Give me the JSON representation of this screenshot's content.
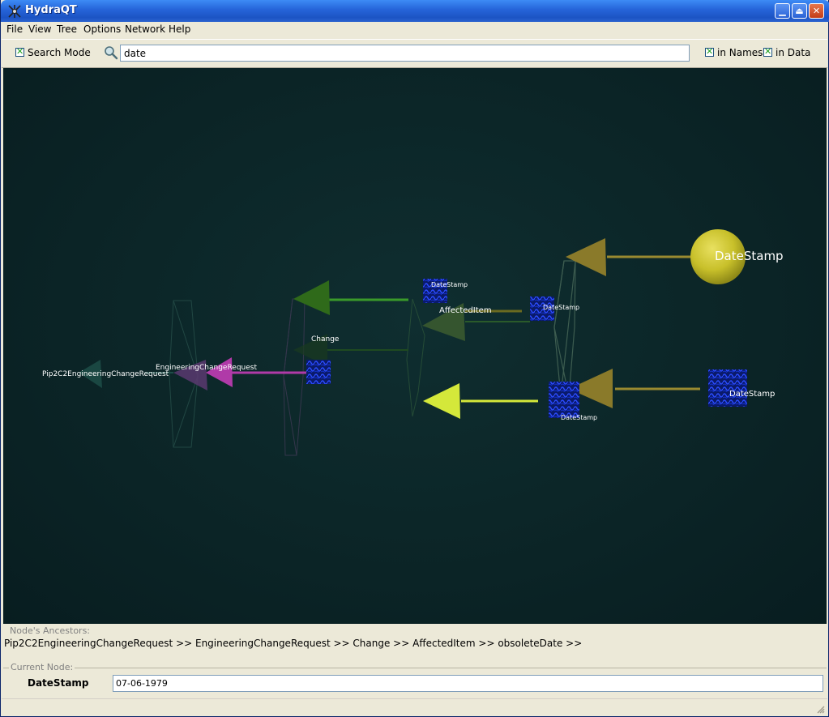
{
  "window": {
    "title": "HydraQT"
  },
  "menu": [
    "File",
    "View",
    "Tree",
    "Options",
    "Network",
    "Help"
  ],
  "toolbar": {
    "search_mode_label": "Search Mode",
    "search_mode_checked": true,
    "search_value": "date",
    "in_names_label": "in Names",
    "in_names_checked": true,
    "in_data_label": "in Data",
    "in_data_checked": true
  },
  "graph": {
    "nodes": {
      "root": "Pip2C2EngineeringChangeRequest",
      "ecr": "EngineeringChangeRequest",
      "change": "Change",
      "affected": "AffectedItem",
      "datestamp_a": "DateStamp",
      "datestamp_b": "DateStamp",
      "datestamp_c": "DateStamp",
      "datestamp_big": "DateStamp",
      "datestamp_right": "DateStamp"
    },
    "colors": {
      "background": "#0b2426",
      "highlight_sphere": "#c8c02a",
      "highlight_cone": "#d4e83a",
      "olive": "#8a7a2a",
      "green": "#2f6a1a",
      "magenta": "#b03aa8",
      "teal": "#1d4d48"
    }
  },
  "ancestors": {
    "legend": "Node's Ancestors:",
    "path": "Pip2C2EngineeringChangeRequest >> EngineeringChangeRequest >> Change >> AffectedItem >> obsoleteDate >>"
  },
  "current_node": {
    "legend": "Current Node:",
    "name": "DateStamp",
    "value": "07-06-1979"
  }
}
